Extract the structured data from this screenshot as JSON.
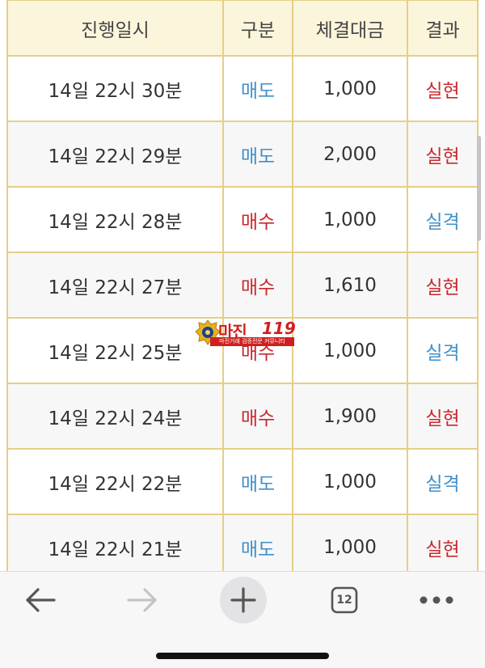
{
  "table": {
    "headers": [
      "진행일시",
      "구분",
      "체결대금",
      "결과"
    ],
    "rows": [
      {
        "time": "14일 22시 30분",
        "type": "매도",
        "amount": "1,000",
        "result": "실현"
      },
      {
        "time": "14일 22시 29분",
        "type": "매도",
        "amount": "2,000",
        "result": "실현"
      },
      {
        "time": "14일 22시 28분",
        "type": "매수",
        "amount": "1,000",
        "result": "실격"
      },
      {
        "time": "14일 22시 27분",
        "type": "매수",
        "amount": "1,610",
        "result": "실현"
      },
      {
        "time": "14일 22시 25분",
        "type": "매수",
        "amount": "1,000",
        "result": "실격"
      },
      {
        "time": "14일 22시 24분",
        "type": "매수",
        "amount": "1,900",
        "result": "실현"
      },
      {
        "time": "14일 22시 22분",
        "type": "매도",
        "amount": "1,000",
        "result": "실격"
      },
      {
        "time": "14일 22시 21분",
        "type": "매도",
        "amount": "1,000",
        "result": "실현"
      }
    ]
  },
  "watermark": {
    "title": "마진",
    "number": "119",
    "subtitle": "마진거래 검증전문 커뮤니티"
  },
  "toolbar": {
    "tab_count": "12",
    "icons": {
      "back": "arrow-left-icon",
      "forward": "arrow-right-icon",
      "new_tab": "plus-icon",
      "tabs": "tab-count-icon",
      "more": "more-dots-icon"
    }
  },
  "colors": {
    "border": "#e4cf86",
    "header_bg": "#fbf5dc",
    "sell_blue": "#3f8fc9",
    "buy_red": "#c9282d",
    "toolbar_bg": "#f7f7f7"
  }
}
